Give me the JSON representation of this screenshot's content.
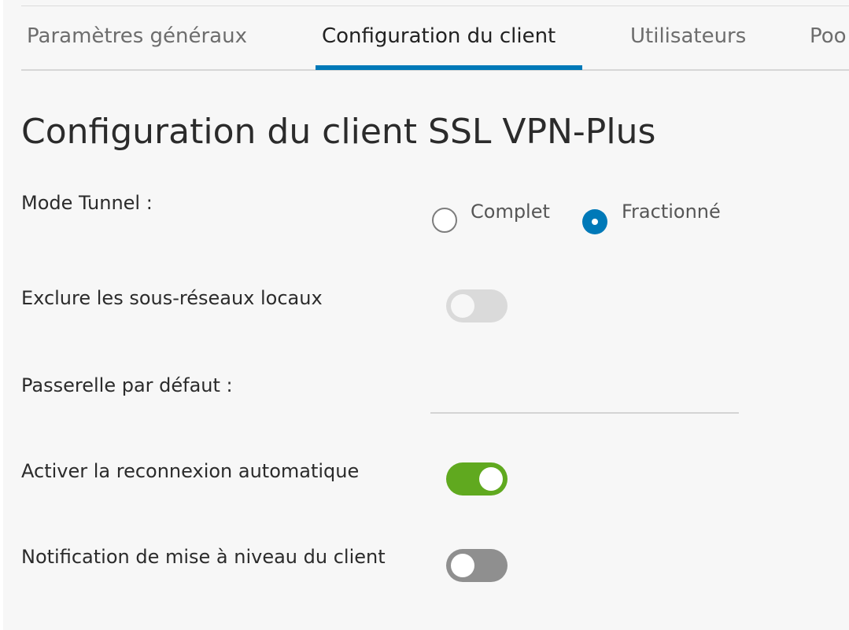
{
  "tabs": [
    {
      "label": "Paramètres généraux",
      "active": false
    },
    {
      "label": "Configuration du client",
      "active": true
    },
    {
      "label": "Utilisateurs",
      "active": false
    },
    {
      "label": "Poo",
      "active": false
    }
  ],
  "page": {
    "title": "Configuration du client SSL VPN-Plus"
  },
  "form": {
    "tunnel_mode": {
      "label": "Mode Tunnel :",
      "options": [
        "Complet",
        "Fractionné"
      ],
      "selected": "Fractionné"
    },
    "exclude_local_subnets": {
      "label": "Exclure les sous-réseaux locaux",
      "state": "off-disabled"
    },
    "default_gateway": {
      "label": "Passerelle par défaut :",
      "value": "",
      "placeholder": ""
    },
    "auto_reconnect": {
      "label": "Activer la reconnexion automatique",
      "state": "on"
    },
    "upgrade_notification": {
      "label": "Notification de mise à niveau du client",
      "state": "off"
    }
  },
  "colors": {
    "accent": "#0079b8",
    "toggle_on": "#60a91f",
    "toggle_off": "#8f8f8f",
    "toggle_disabled": "#dadada"
  }
}
